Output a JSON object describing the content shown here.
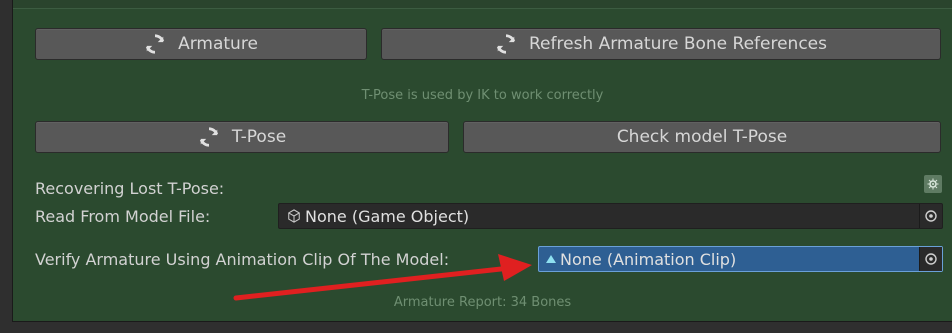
{
  "buttons": {
    "armature": "Armature",
    "refresh_refs": "Refresh Armature Bone References",
    "tpose": "T-Pose",
    "check_tpose": "Check model T-Pose"
  },
  "hints": {
    "tpose_info": "T-Pose is used by IK to work correctly",
    "armature_report": "Armature Report: 34 Bones"
  },
  "fields": {
    "recovering_label": "Recovering Lost T-Pose:",
    "read_from_label": "Read From Model File:",
    "read_from_value": "None (Game Object)",
    "verify_label": "Verify Armature Using Animation Clip Of The Model:",
    "verify_value": "None (Animation Clip)"
  },
  "colors": {
    "panel_bg": "#2b4a2f",
    "button_bg": "#585858",
    "selected_field": "#2e5f93",
    "arrow": "#e02020"
  },
  "icons": {
    "refresh": "refresh-icon",
    "gameobject": "cube-icon",
    "animclip": "triangle-icon",
    "object_picker": "object-picker-icon",
    "settings": "gear-icon"
  }
}
